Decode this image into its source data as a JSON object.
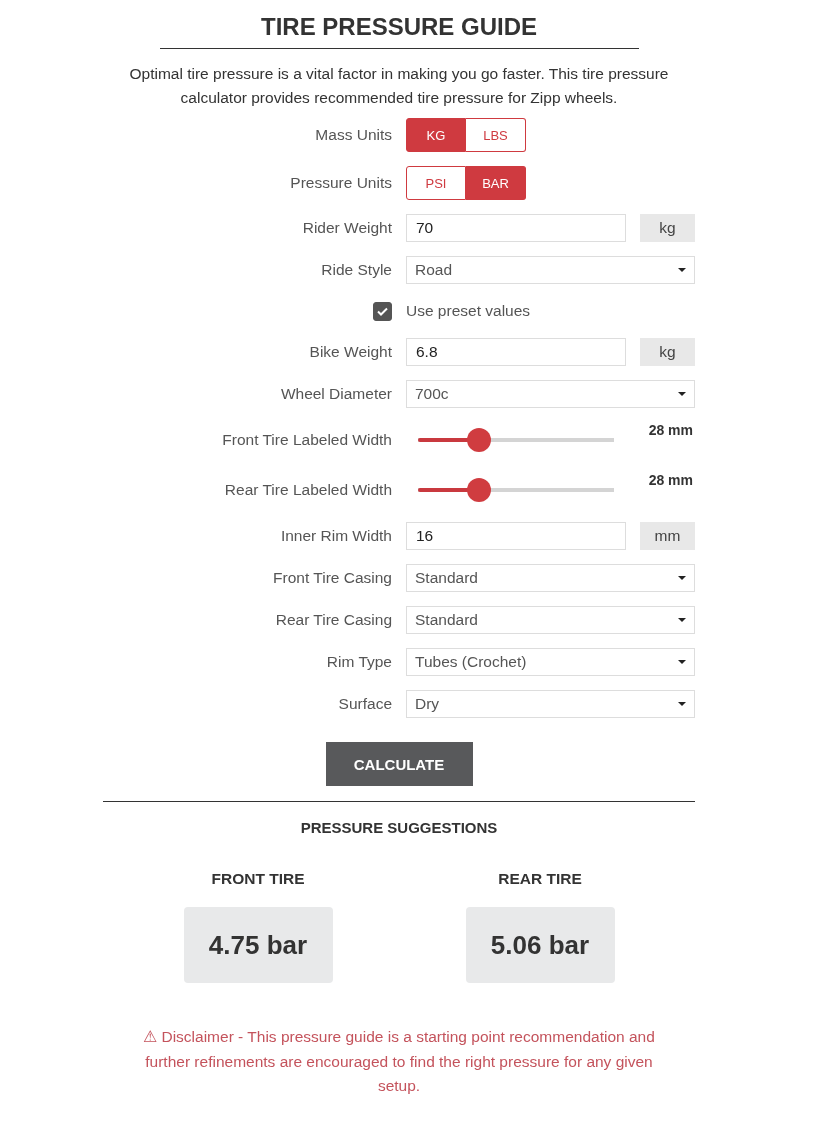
{
  "title": "TIRE PRESSURE GUIDE",
  "intro": "Optimal tire pressure is a vital factor in making you go faster. This tire pressure calculator provides recommended tire pressure for Zipp wheels.",
  "fields": [
    {
      "kind": "toggle",
      "label": "Mass Units",
      "options": [
        {
          "label": "KG",
          "selected": true
        },
        {
          "label": "LBS",
          "selected": false
        }
      ]
    },
    {
      "kind": "toggle",
      "label": "Pressure Units",
      "options": [
        {
          "label": "PSI",
          "selected": false
        },
        {
          "label": "BAR",
          "selected": true
        }
      ]
    },
    {
      "kind": "number",
      "label": "Rider Weight",
      "value": "70",
      "unit": "kg"
    },
    {
      "kind": "select",
      "label": "Ride Style",
      "value": "Road"
    },
    {
      "kind": "checkbox",
      "label": "Use preset values",
      "checked": true
    },
    {
      "kind": "number",
      "label": "Bike Weight",
      "value": "6.8",
      "unit": "kg"
    },
    {
      "kind": "select",
      "label": "Wheel Diameter",
      "value": "700c"
    },
    {
      "kind": "slider",
      "label": "Front Tire Labeled Width",
      "level": 0.31,
      "reading": "28 mm"
    },
    {
      "kind": "slider",
      "label": "Rear Tire Labeled Width",
      "level": 0.31,
      "reading": "28 mm"
    },
    {
      "kind": "number",
      "label": "Inner Rim Width",
      "value": "16",
      "unit": "mm"
    },
    {
      "kind": "select",
      "label": "Front Tire Casing",
      "value": "Standard"
    },
    {
      "kind": "select",
      "label": "Rear Tire Casing",
      "value": "Standard"
    },
    {
      "kind": "select",
      "label": "Rim Type",
      "value": "Tubes (Crochet)"
    },
    {
      "kind": "select",
      "label": "Surface",
      "value": "Dry"
    }
  ],
  "calculate_button": "CALCULATE",
  "results": {
    "title": "PRESSURE SUGGESTIONS",
    "tires": [
      {
        "label": "FRONT TIRE",
        "value": "4.75 bar"
      },
      {
        "label": "REAR TIRE",
        "value": "5.06 bar"
      }
    ]
  },
  "disclaimer": "⚠ Disclaimer - This pressure guide is a starting point recommendation and further refinements are encouraged to find the right pressure for any given setup."
}
